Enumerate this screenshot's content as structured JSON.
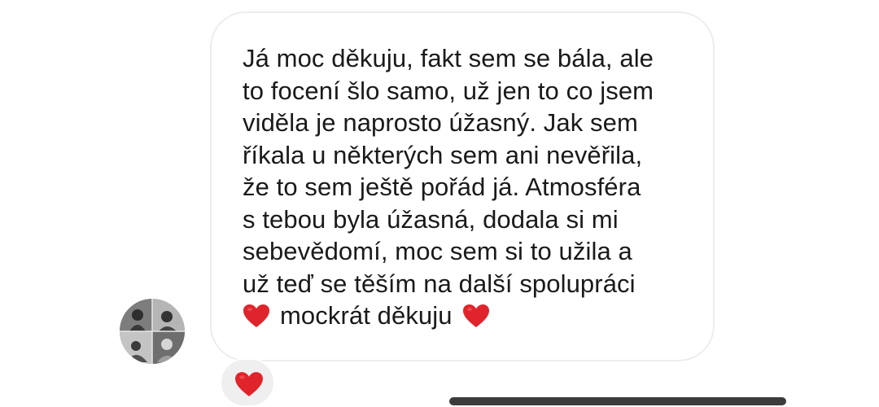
{
  "message": {
    "lines": [
      "Já moc děkuju, fakt sem se bála, ale",
      "to focení šlo samo, už jen to co jsem",
      "viděla je naprosto úžasný. Jak sem",
      "říkala u některých sem ani nevěřila,",
      "že to sem ještě pořád já. Atmosféra",
      "s tebou byla úžasná, dodala si mi",
      "sebevědomí, moc sem si to užila a",
      "už teď se těším na další spolupráci"
    ],
    "last_line_text": "mockrát děkuju",
    "emoji": "red-heart"
  },
  "reaction": {
    "emoji": "red-heart"
  },
  "colors": {
    "heart": "#e0242b",
    "bubble_border": "#ededed",
    "text": "#1a1a1a",
    "reaction_bg": "#efefef"
  }
}
